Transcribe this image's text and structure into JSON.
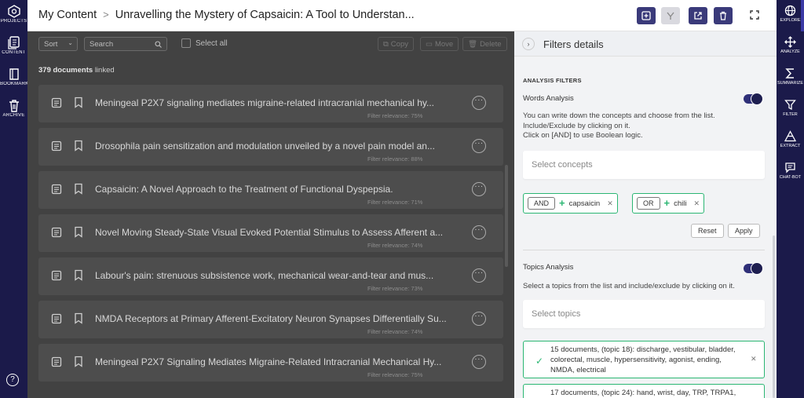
{
  "left_sidebar": {
    "items": [
      {
        "label": "PROJECTS",
        "icon": "hexagon-icon"
      },
      {
        "label": "CONTENT",
        "icon": "document-stack-icon"
      },
      {
        "label": "BOOKMARKS",
        "icon": "book-icon"
      },
      {
        "label": "ARCHIVE",
        "icon": "trash-icon"
      }
    ],
    "help": "?"
  },
  "header": {
    "breadcrumb_root": "My Content",
    "breadcrumb_sep": ">",
    "breadcrumb_current": "Unravelling the Mystery of Capsaicin: A Tool to Understan..."
  },
  "toolbar": {
    "sort": "Sort",
    "search_placeholder": "Search",
    "select_all": "Select all",
    "copy": "Copy",
    "move": "Move",
    "delete": "Delete"
  },
  "doc_count": {
    "number": "379 documents",
    "suffix": "linked"
  },
  "documents": [
    {
      "title": "Meningeal P2X7 signaling mediates migraine-related intracranial mechanical hy...",
      "relevance": "Filter relevance:  75%"
    },
    {
      "title": "Drosophila pain sensitization and modulation unveiled by a novel pain model an...",
      "relevance": "Filter relevance:  88%"
    },
    {
      "title": "Capsaicin: A Novel Approach to the Treatment of Functional Dyspepsia.",
      "relevance": "Filter relevance:  71%"
    },
    {
      "title": "Novel Moving Steady-State Visual Evoked Potential Stimulus to Assess Afferent a...",
      "relevance": "Filter relevance:  74%"
    },
    {
      "title": "Labour's pain: strenuous subsistence work, mechanical wear-and-tear and mus...",
      "relevance": "Filter relevance:  73%"
    },
    {
      "title": "NMDA Receptors at Primary Afferent-Excitatory Neuron Synapses Differentially Su...",
      "relevance": "Filter relevance:  74%"
    },
    {
      "title": "Meningeal P2X7 Signaling Mediates Migraine-Related Intracranial Mechanical Hy...",
      "relevance": "Filter relevance:  75%"
    }
  ],
  "filters": {
    "title": "Filters details",
    "section": "ANALYSIS FILTERS",
    "words": {
      "label": "Words Analysis",
      "enabled": true,
      "help1": "You can write down the concepts and choose from the list.",
      "help2": "Include/Exclude by clicking on it.",
      "help3": "Click on [AND] to use Boolean logic.",
      "placeholder": "Select concepts",
      "chips": [
        {
          "op": "AND",
          "term": "capsaicin"
        },
        {
          "op": "OR",
          "term": "chili"
        }
      ],
      "reset": "Reset",
      "apply": "Apply"
    },
    "topics": {
      "label": "Topics Analysis",
      "enabled": true,
      "help": "Select a topics from the list and include/exclude by clicking on it.",
      "placeholder": "Select topics",
      "items": [
        {
          "text": "15 documents, (topic 18): discharge, vestibular, bladder, colorectal, muscle, hypersensitivity, agonist, ending, NMDA, electrical"
        },
        {
          "text": "17 documents, (topic 24): hand, wrist, day, TRP, TRPA1,"
        }
      ]
    }
  },
  "right_sidebar": {
    "items": [
      {
        "label": "EXPLORE",
        "icon": "globe-icon"
      },
      {
        "label": "ANALYZE",
        "icon": "move-arrows-icon"
      },
      {
        "label": "SUMMARIZE",
        "icon": "sigma-icon"
      },
      {
        "label": "FILTER",
        "icon": "funnel-icon"
      },
      {
        "label": "EXTRACT",
        "icon": "pyramid-icon"
      },
      {
        "label": "CHAT-BOT",
        "icon": "chat-icon"
      }
    ]
  },
  "colors": {
    "brand_navy": "#1b1a4a",
    "accent_green": "#2bb673",
    "toggle_navy": "#2f2f78"
  }
}
